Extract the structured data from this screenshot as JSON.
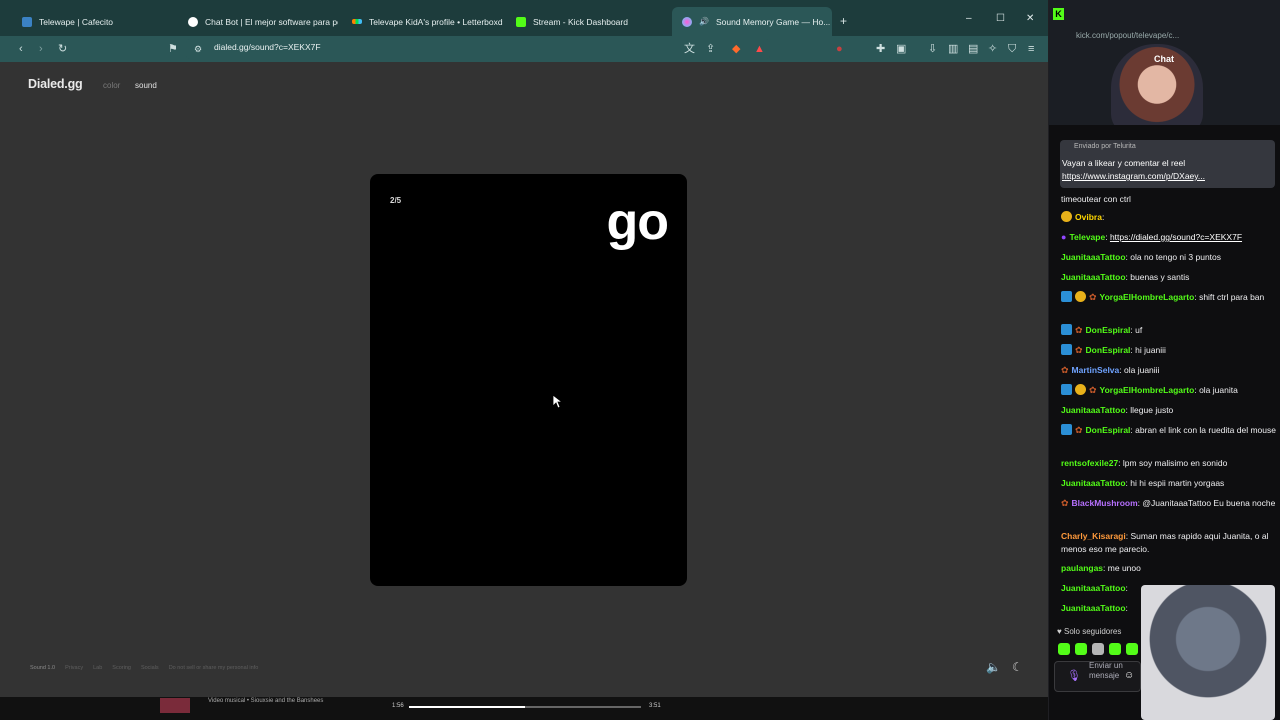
{
  "browser": {
    "tabs": [
      {
        "title": "Telewape | Cafecito",
        "favicon_color": "#3b82c4"
      },
      {
        "title": "Chat Bot | El mejor software para po...",
        "favicon_color": "#ffffff"
      },
      {
        "title": "Televape KidA's profile • Letterboxd",
        "favicon_color": "#ff8000"
      },
      {
        "title": "Stream - Kick Dashboard",
        "favicon_color": "#53fc18"
      },
      {
        "title": "Sound Memory Game — Ho...",
        "favicon_color": "#e05cdb"
      }
    ],
    "new_tab": "+",
    "url": "dialed.gg/sound?c=XEKX7F",
    "window_controls": {
      "minimize": "–",
      "maximize": "☐",
      "close": "✕"
    }
  },
  "page": {
    "logo": "Dialed.gg",
    "nav": {
      "color": "color",
      "sound": "sound"
    },
    "card": {
      "counter": "2/5",
      "word": "go"
    },
    "footer": [
      "Sound 1.0",
      "Privacy",
      "Lab",
      "Scoring",
      "Socials",
      "Do not sell or share my personal info"
    ]
  },
  "media_bar": {
    "title": "Video musical • Siouxsie and the Banshees",
    "time_current": "1:56",
    "time_total": "3:51",
    "progress": 0.5
  },
  "chat": {
    "url": "kick.com/popout/televape/c...",
    "title": "Chat",
    "pinned_by": "Enviado por Telurita",
    "pinned_text": "Vayan a likear y comentar el reel",
    "pinned_link": "https://www.instagram.com/p/DXaey...",
    "pre_line": "timeoutear con ctrl",
    "messages": [
      {
        "user": "Ovibra",
        "text": "",
        "color": "#ffd700",
        "badges": [
          "gold"
        ]
      },
      {
        "user": "Televape",
        "text": "https://dialed.gg/sound?c=XEKX7F",
        "color": "#53fc18",
        "badges": [
          "purple"
        ],
        "link": true
      },
      {
        "user": "JuanitaaaTattoo",
        "text": "ola no tengo ni 3 puntos",
        "color": "#53fc18",
        "badges": []
      },
      {
        "user": "JuanitaaaTattoo",
        "text": "buenas y santis",
        "color": "#53fc18",
        "badges": []
      },
      {
        "user": "YorgaElHombreLagarto",
        "text": "shift ctrl para ban",
        "color": "#53fc18",
        "badges": [
          "blue",
          "gold",
          "leaf"
        ]
      },
      {
        "user": "DonEspiral",
        "text": "uf",
        "color": "#53fc18",
        "badges": [
          "blue",
          "leaf"
        ]
      },
      {
        "user": "DonEspiral",
        "text": "hi juaniii",
        "color": "#53fc18",
        "badges": [
          "blue",
          "leaf"
        ]
      },
      {
        "user": "MartinSelva",
        "text": "ola juaniii",
        "color": "#6fa3ff",
        "badges": [
          "leaf"
        ]
      },
      {
        "user": "YorgaElHombreLagarto",
        "text": "ola juanita",
        "color": "#53fc18",
        "badges": [
          "blue",
          "gold",
          "leaf"
        ]
      },
      {
        "user": "JuanitaaaTattoo",
        "text": "llegue justo",
        "color": "#53fc18",
        "badges": []
      },
      {
        "user": "DonEspiral",
        "text": "abran el link con la ruedita del mouse",
        "color": "#53fc18",
        "badges": [
          "blue",
          "leaf"
        ]
      },
      {
        "user": "rentsofexile27",
        "text": "lpm soy malisimo en sonido",
        "color": "#53fc18",
        "badges": []
      },
      {
        "user": "JuanitaaaTattoo",
        "text": "hi hi espii martin yorgaas",
        "color": "#53fc18",
        "badges": []
      },
      {
        "user": "BlackMushroom",
        "text": "@JuanitaaaTattoo Eu buena noche",
        "color": "#b770ff",
        "badges": [
          "leaf"
        ]
      },
      {
        "user": "Charly_Kisaragi",
        "text": "Suman mas rapido aqui Juanita, o al menos eso me parecio.",
        "color": "#ff9a3c",
        "badges": []
      },
      {
        "user": "paulangas",
        "text": "me unoo",
        "color": "#53fc18",
        "badges": []
      },
      {
        "user": "JuanitaaaTattoo",
        "text": "",
        "color": "#53fc18",
        "badges": []
      },
      {
        "user": "JuanitaaaTattoo",
        "text": "",
        "color": "#53fc18",
        "badges": []
      }
    ],
    "followers_only": "Solo seguidores",
    "input_placeholder": "Enviar un mensaje"
  }
}
